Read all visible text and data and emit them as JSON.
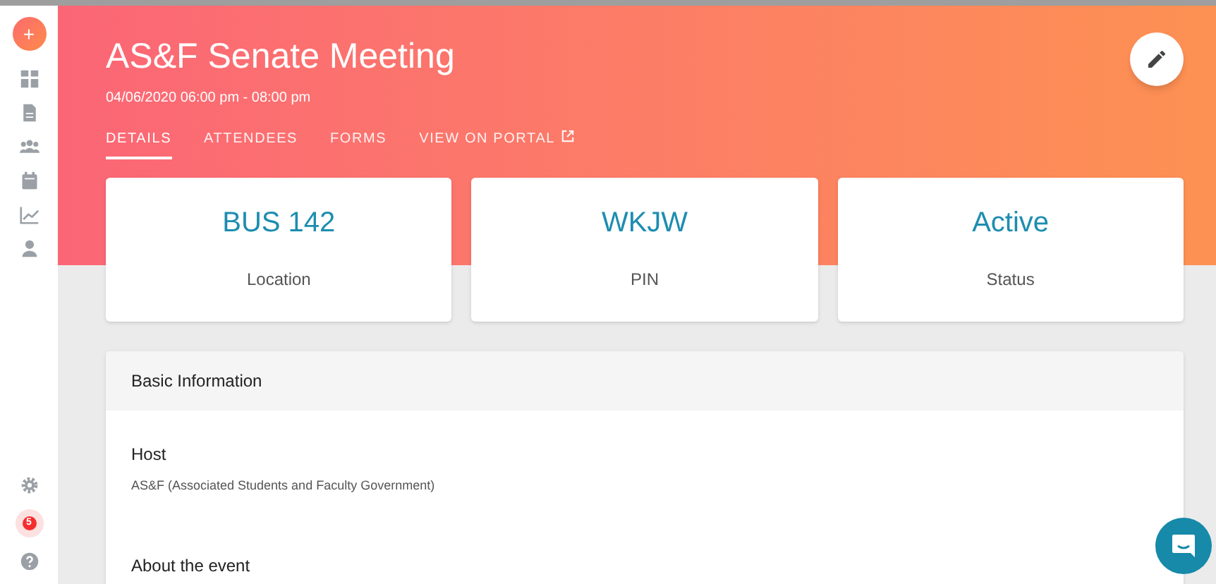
{
  "event": {
    "title": "AS&F Senate Meeting",
    "datetime": "04/06/2020 06:00 pm - 08:00 pm"
  },
  "sidebar": {
    "add_label": "+",
    "items": [
      {
        "kind": "dashboard"
      },
      {
        "kind": "document"
      },
      {
        "kind": "people"
      },
      {
        "kind": "calendar"
      },
      {
        "kind": "chart"
      },
      {
        "kind": "person"
      }
    ],
    "bottom": [
      {
        "kind": "settings"
      },
      {
        "kind": "notifications",
        "badge": "5"
      },
      {
        "kind": "help"
      }
    ]
  },
  "tabs": [
    {
      "label": "DETAILS",
      "selected": true,
      "external": false
    },
    {
      "label": "ATTENDEES",
      "selected": false,
      "external": false
    },
    {
      "label": "FORMS",
      "selected": false,
      "external": false
    },
    {
      "label": "VIEW ON PORTAL",
      "selected": false,
      "external": true
    }
  ],
  "stats": [
    {
      "value": "BUS 142",
      "label": "Location"
    },
    {
      "value": "WKJW",
      "label": "PIN"
    },
    {
      "value": "Active",
      "label": "Status"
    }
  ],
  "basic_information": {
    "title": "Basic Information",
    "fields": [
      {
        "label": "Host",
        "value": "AS&F (Associated Students and Faculty Government)"
      },
      {
        "label": "About the event"
      }
    ]
  }
}
